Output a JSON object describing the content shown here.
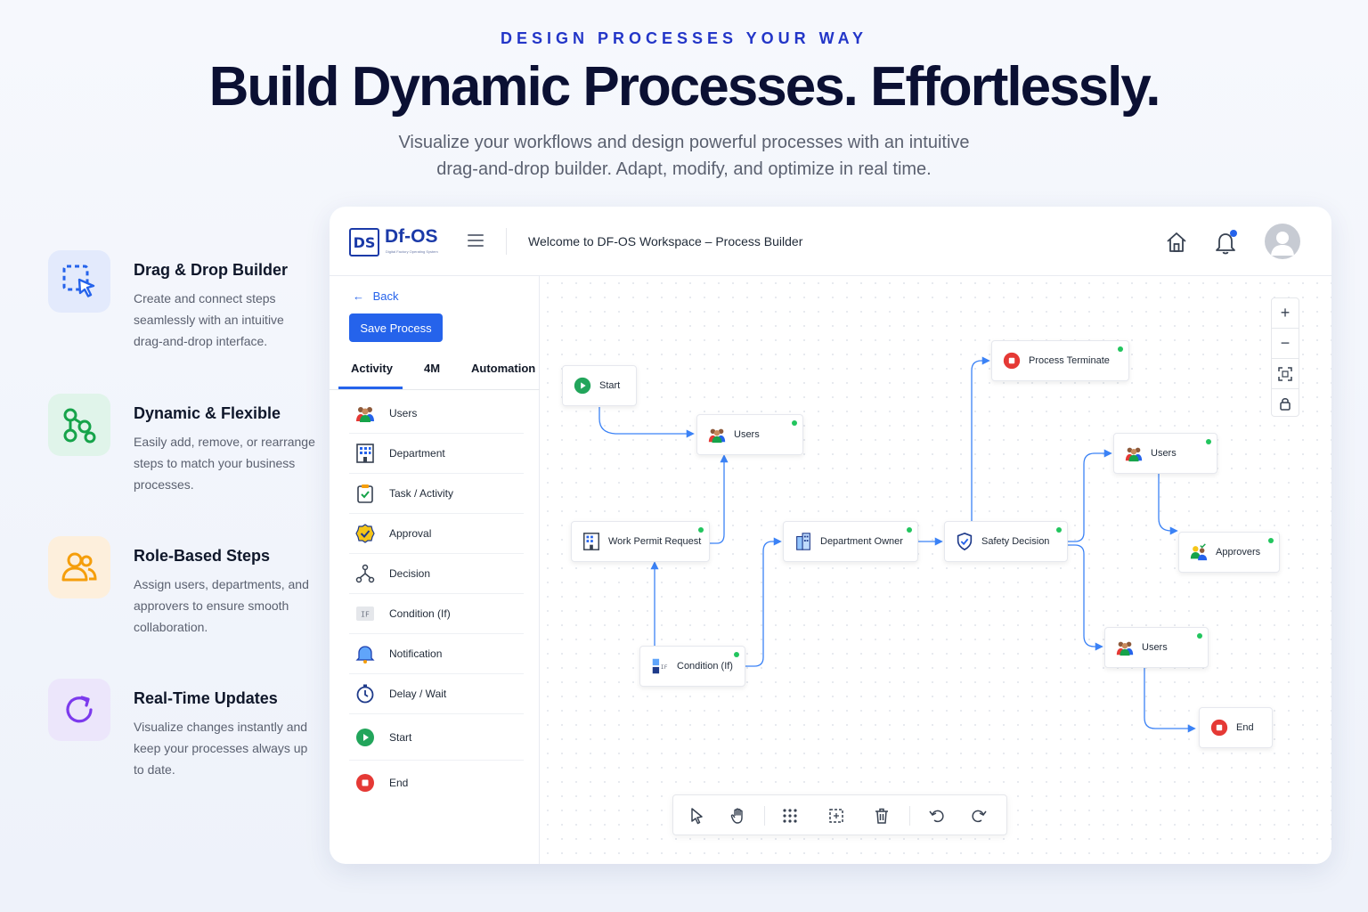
{
  "hero": {
    "eyebrow": "DESIGN PROCESSES YOUR WAY",
    "headline": "Build Dynamic Processes. Effortlessly.",
    "subline_1": "Visualize your workflows and design powerful processes with an intuitive",
    "subline_2": "drag-and-drop builder. Adapt, modify, and optimize in real time."
  },
  "features": [
    {
      "title": "Drag & Drop Builder",
      "desc": "Create and connect steps seamlessly with an intuitive drag-and-drop interface.",
      "icon": "drag-select-icon",
      "color": "#2563eb",
      "bg": "#e3eafc"
    },
    {
      "title": "Dynamic & Flexible",
      "desc": "Easily add, remove, or rearrange steps to match your business processes.",
      "icon": "nodes-graph-icon",
      "color": "#16a34a",
      "bg": "#e0f4ea"
    },
    {
      "title": "Role-Based Steps",
      "desc": "Assign users, departments, and approvers to ensure smooth collaboration.",
      "icon": "users-icon",
      "color": "#f59e0b",
      "bg": "#fdefdc"
    },
    {
      "title": "Real-Time Updates",
      "desc": "Visualize changes instantly and keep your processes always up to date.",
      "icon": "refresh-icon",
      "color": "#7c3aed",
      "bg": "#ece6fb"
    }
  ],
  "app": {
    "logo_mark": "DS",
    "logo_name": "Df-OS",
    "logo_tagline": "Digital Factory Operating System",
    "welcome": "Welcome to DF-OS Workspace – Process Builder",
    "back_label": "Back",
    "save_label": "Save Process",
    "tabs": [
      "Activity",
      "4M",
      "Automation"
    ],
    "active_tab": "Activity",
    "palette": [
      {
        "label": "Users",
        "icon": "users-group-icon"
      },
      {
        "label": "Department",
        "icon": "building-icon"
      },
      {
        "label": "Task / Activity",
        "icon": "clipboard-check-icon"
      },
      {
        "label": "Approval",
        "icon": "approval-badge-icon"
      },
      {
        "label": "Decision",
        "icon": "decision-branch-icon"
      },
      {
        "label": "Condition (If)",
        "icon": "condition-if-icon"
      },
      {
        "label": "Notification",
        "icon": "bell-icon"
      },
      {
        "label": "Delay / Wait",
        "icon": "timer-icon"
      },
      {
        "label": "Start",
        "icon": "play-icon"
      },
      {
        "label": "End",
        "icon": "stop-icon"
      }
    ],
    "nodes": {
      "start": "Start",
      "users1": "Users",
      "work_permit": "Work Permit Request",
      "condition": "Condition (If)",
      "dept_owner": "Department Owner",
      "safety": "Safety Decision",
      "terminate": "Process Terminate",
      "users2": "Users",
      "approvers": "Approvers",
      "users3": "Users",
      "end": "End"
    },
    "colors": {
      "accent": "#2563eb",
      "edge": "#3b82f6",
      "status_ok": "#22c55e",
      "start": "#22a55b",
      "end": "#e53935"
    }
  }
}
